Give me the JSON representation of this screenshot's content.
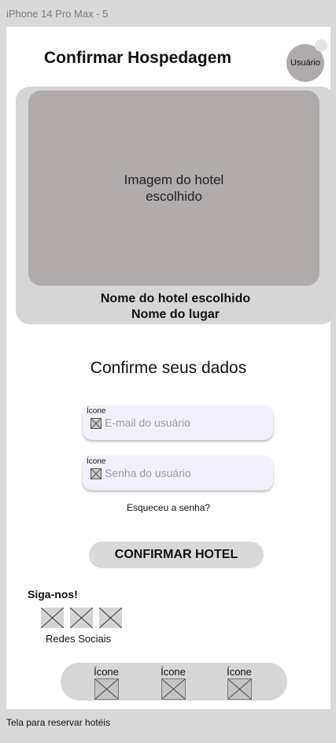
{
  "frame_label": "iPhone 14 Pro Max - 5",
  "header": {
    "title": "Confirmar Hospedagem",
    "avatar_label": "Usuário"
  },
  "hotel": {
    "image_placeholder": "Imagem do hotel escolhido",
    "name": "Nome do hotel escolhido",
    "place": "Nome do lugar"
  },
  "form": {
    "title": "Confirme seus dados",
    "email": {
      "icon_label": "Ícone",
      "placeholder": "E-mail do usuário"
    },
    "password": {
      "icon_label": "Ícone",
      "placeholder": "Senha do usuário"
    },
    "forgot_link": "Esqueceu a senha?",
    "confirm_button": "CONFIRMAR HOTEL"
  },
  "social": {
    "title": "Siga-nos!",
    "label": "Redes Sociais",
    "icons": [
      "placeholder-icon",
      "placeholder-icon",
      "placeholder-icon"
    ]
  },
  "bottom_nav": {
    "items": [
      {
        "label": "Ícone",
        "icon": "placeholder-icon"
      },
      {
        "label": "Ícone",
        "icon": "placeholder-icon"
      },
      {
        "label": "Ícone",
        "icon": "placeholder-icon"
      }
    ]
  },
  "caption": "Tela para reservar hotéis",
  "colors": {
    "background": "#d9d9d9",
    "screen": "#ffffff",
    "card": "#d6d6d6",
    "image_placeholder": "#b0aaaa",
    "input_fill": "#f2f1fb"
  }
}
